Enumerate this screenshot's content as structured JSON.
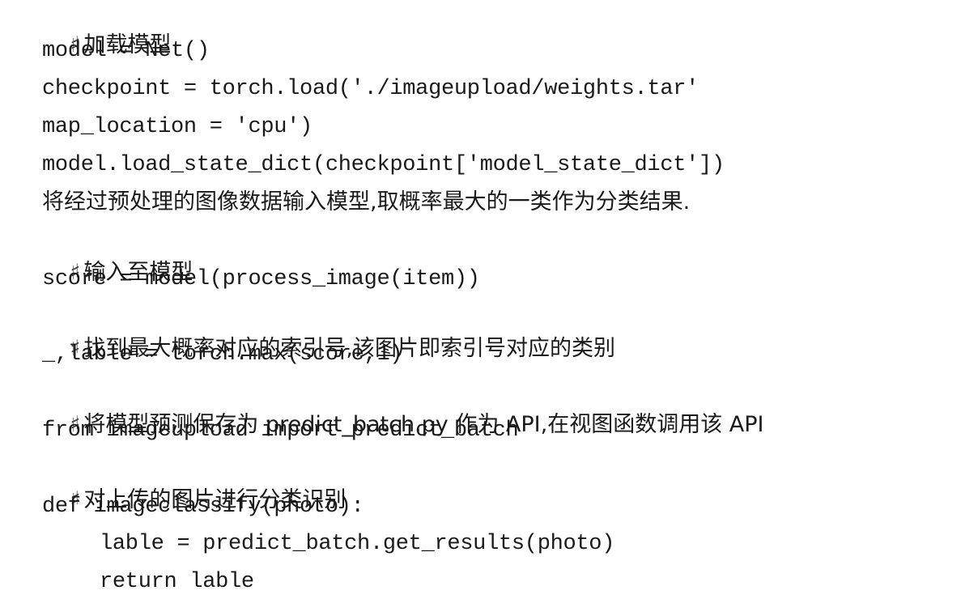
{
  "document": {
    "lines": [
      {
        "kind": "comment",
        "marker": "♯",
        "text": "加载模型"
      },
      {
        "kind": "code",
        "text": "model = Net()"
      },
      {
        "kind": "code",
        "text": "checkpoint = torch.load('./imageupload/weights.tar'"
      },
      {
        "kind": "code",
        "text": "map_location = 'cpu')"
      },
      {
        "kind": "code",
        "text": "model.load_state_dict(checkpoint['model_state_dict'])"
      },
      {
        "kind": "prose",
        "text": "将经过预处理的图像数据输入模型,取概率最大的一类作为分类结果."
      },
      {
        "kind": "comment",
        "marker": "♯",
        "text": "输入至模型"
      },
      {
        "kind": "code",
        "text": "score = model(process_image(item))"
      },
      {
        "kind": "comment",
        "marker": "♯",
        "text": "找到最大概率对应的索引号,该图片即索引号对应的类别"
      },
      {
        "kind": "code",
        "text": "_,lable = torch.max(score,1)"
      },
      {
        "kind": "comment",
        "marker": "♯",
        "text": "将模型预测保存为 predict_batch.py 作为 API,在视图函数调用该 API"
      },
      {
        "kind": "code",
        "text": "from imageupload import predict_batch"
      },
      {
        "kind": "comment",
        "marker": "♯",
        "text": "对上传的图片进行分类识别"
      },
      {
        "kind": "code",
        "text": "def imageclassify(photo):"
      },
      {
        "kind": "code-indent",
        "text": "lable = predict_batch.get_results(photo)"
      },
      {
        "kind": "code-indent",
        "text": "return lable"
      }
    ]
  }
}
